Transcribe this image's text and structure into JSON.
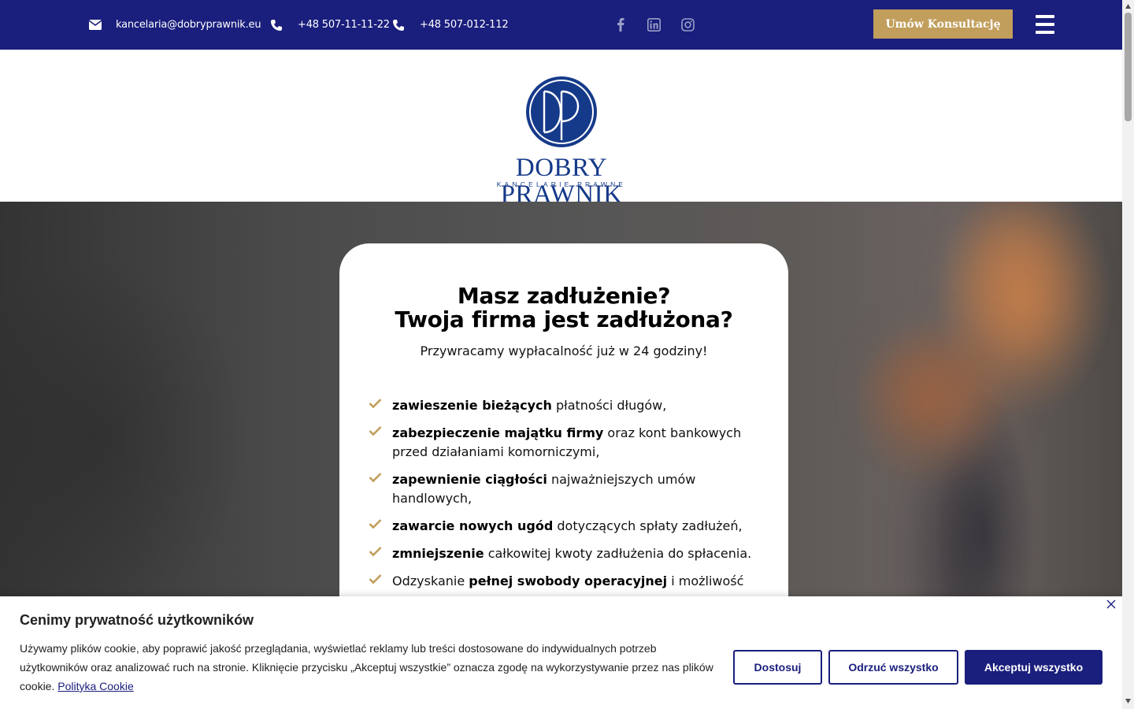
{
  "topbar": {
    "email": "kancelaria@dobryprawnik.eu",
    "phone1": "+48 507-11-11-22",
    "phone2": "+48 507-012-112",
    "cta_label": "Umów Konsultację",
    "bg_color": "#1a1e7c",
    "accent_color": "#c19e5c",
    "icons": [
      "envelope-icon",
      "phone-icon",
      "phone-icon",
      "facebook-icon",
      "linkedin-icon",
      "instagram-icon",
      "menu-icon"
    ]
  },
  "logo": {
    "wordmark": "DOBRY PRAWNIK",
    "tagline": "KANCELARIE PRAWNE",
    "color": "#163a8a"
  },
  "hero": {
    "title_line1": "Masz zadłużenie?",
    "title_line2": "Twoja firma jest zadłużona?",
    "subtitle": "Przywracamy wypłacalność już w 24 godziny!",
    "items": [
      {
        "bold": "zawieszenie bieżących",
        "rest": " płatności długów,"
      },
      {
        "bold": "zabezpieczenie majątku firmy",
        "rest": " oraz kont bankowych przed działaniami komorniczymi,"
      },
      {
        "bold": "zapewnienie ciągłości",
        "rest": " najważniejszych umów handlowych,"
      },
      {
        "bold": "zawarcie nowych ugód",
        "rest": " dotyczących spłaty zadłużeń,"
      },
      {
        "bold": "zmniejszenie",
        "rest": " całkowitej kwoty zadłużenia do spłacenia."
      },
      {
        "pre": "Odzyskanie ",
        "bold": "pełnej swobody operacyjnej",
        "rest": " i możliwość"
      }
    ],
    "check_color": "#c19e5c"
  },
  "cookie": {
    "title": "Cenimy prywatność użytkowników",
    "text": "Używamy plików cookie, aby poprawić jakość przeglądania, wyświetlać reklamy lub treści dostosowane do indywidualnych potrzeb użytkowników oraz analizować ruch na stronie. Kliknięcie przycisku „Akceptuj wszystkie” oznacza zgodę na wykorzystywanie przez nas plików cookie.",
    "link": "Polityka Cookie",
    "btn_customize": "Dostosuj",
    "btn_reject": "Odrzuć wszystko",
    "btn_accept": "Akceptuj wszystko"
  }
}
